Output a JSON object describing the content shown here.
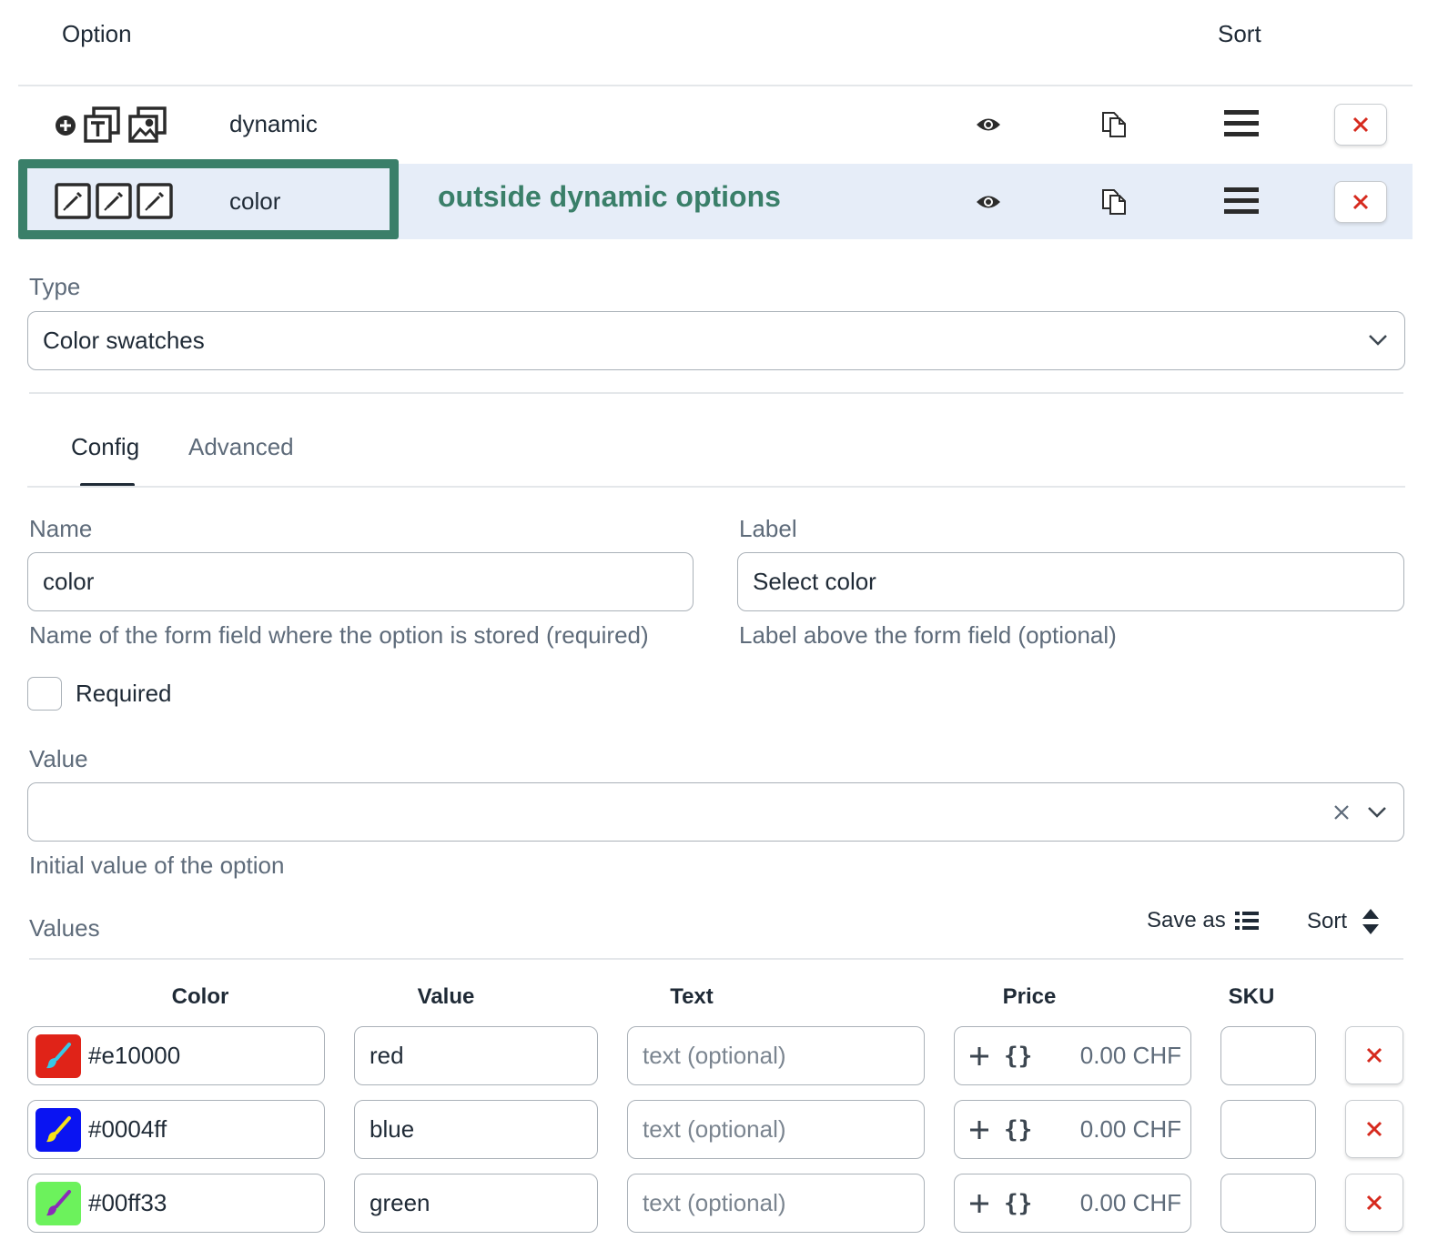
{
  "header": {
    "option_label": "Option",
    "sort_label": "Sort"
  },
  "rows": [
    {
      "name": "dynamic"
    },
    {
      "name": "color"
    }
  ],
  "annotation": {
    "text": "outside dynamic options",
    "color": "#3a7f69"
  },
  "type_section": {
    "label": "Type",
    "selected": "Color swatches"
  },
  "tabs": [
    {
      "label": "Config"
    },
    {
      "label": "Advanced"
    }
  ],
  "config": {
    "name": {
      "label": "Name",
      "value": "color",
      "help": "Name of the form field where the option is stored (required)"
    },
    "label": {
      "label": "Label",
      "value": "Select color",
      "help": "Label above the form field (optional)"
    },
    "required": {
      "label": "Required"
    },
    "value": {
      "label": "Value",
      "help": "Initial value of the option"
    }
  },
  "values_section": {
    "label": "Values",
    "save_as": "Save as",
    "sort": "Sort",
    "columns": [
      "Color",
      "Value",
      "Text",
      "Price",
      "SKU"
    ],
    "rows": [
      {
        "color": "#e10000",
        "swatch": "#e02318",
        "brush": "cyan",
        "value": "red",
        "text_placeholder": "text (optional)",
        "price": "0.00 CHF"
      },
      {
        "color": "#0004ff",
        "swatch": "#0a14f2",
        "brush": "yellow",
        "value": "blue",
        "text_placeholder": "text (optional)",
        "price": "0.00 CHF"
      },
      {
        "color": "#00ff33",
        "swatch": "#6cf25c",
        "brush": "purple",
        "value": "green",
        "text_placeholder": "text (optional)",
        "price": "0.00 CHF"
      }
    ]
  },
  "colors": {
    "highlight_row": "#e6edf8",
    "highlight_border": "#3a7f69",
    "delete_x": "#d62a1e"
  },
  "icons": [
    "plus-circle-icon",
    "text-copy-icon",
    "image-copy-icon",
    "edit-icon",
    "eye-icon",
    "copy-icon",
    "drag-handle-icon",
    "close-icon",
    "chevron-down-icon",
    "list-icon",
    "sort-icon",
    "brush-icon",
    "curly-braces-icon",
    "plus-icon"
  ]
}
